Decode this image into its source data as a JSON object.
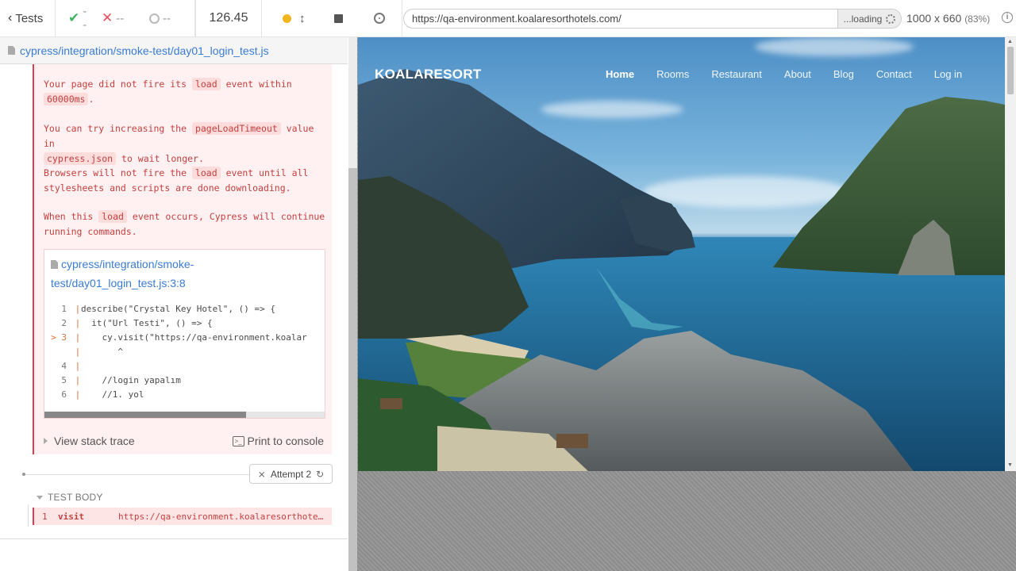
{
  "reporter": {
    "header": {
      "tests_label": "Tests",
      "passed": "--",
      "failed": "--",
      "pending": "--",
      "duration": "126.45"
    },
    "spec_path": "cypress/integration/smoke-test/day01_login_test.js",
    "error": {
      "p1_before": "Your page did not fire its",
      "p1_tag": "load",
      "p1_after": "event within",
      "p1_tag2": "60000ms",
      "p1_end": ".",
      "p2_before": "You can try increasing the",
      "p2_tag": "pageLoadTimeout",
      "p2_after": "value in",
      "p2_tag2": "cypress.json",
      "p2_end": "to wait longer.",
      "p3_before": "Browsers will not fire the",
      "p3_tag": "load",
      "p3_after": "event until all",
      "p3_line2": "stylesheets and scripts are done downloading.",
      "p4_before": "When this",
      "p4_tag": "load",
      "p4_after": "event occurs, Cypress will continue",
      "p4_line2": "running commands.",
      "code_frame_path": "cypress/integration/smoke-test/day01_login_test.js:3:8",
      "code_lines": [
        {
          "num": "1",
          "text": "describe(\"Crystal Key Hotel\", () => {",
          "marker": ""
        },
        {
          "num": "2",
          "text": "  it(\"Url Testi\", () => {",
          "marker": ""
        },
        {
          "num": "3",
          "text": "    cy.visit(\"https://qa-environment.koalar",
          "marker": ">"
        },
        {
          "num": "",
          "text": "       ^",
          "marker": ""
        },
        {
          "num": "4",
          "text": "",
          "marker": ""
        },
        {
          "num": "5",
          "text": "    //login yapalım",
          "marker": ""
        },
        {
          "num": "6",
          "text": "    //1. yol",
          "marker": ""
        }
      ],
      "view_stack_trace": "View stack trace",
      "print_to_console": "Print to console"
    },
    "attempt_label": "Attempt 2",
    "test_body_label": "TEST BODY",
    "command": {
      "num": "1",
      "name": "visit",
      "message": "https://qa-environment.koalaresorthotels.com/"
    }
  },
  "aut": {
    "url": "https://qa-environment.koalaresorthotels.com/",
    "loading_label": "...loading",
    "viewport": "1000 x 660",
    "scale": "(83%)",
    "site": {
      "brand": "KOALARESORT",
      "nav": [
        "Home",
        "Rooms",
        "Restaurant",
        "About",
        "Blog",
        "Contact",
        "Log in"
      ]
    }
  },
  "colors": {
    "error_red": "#e03d55",
    "error_bg": "#fff1f1",
    "pass_green": "#3fb466",
    "link_blue": "#3a7bd5"
  }
}
